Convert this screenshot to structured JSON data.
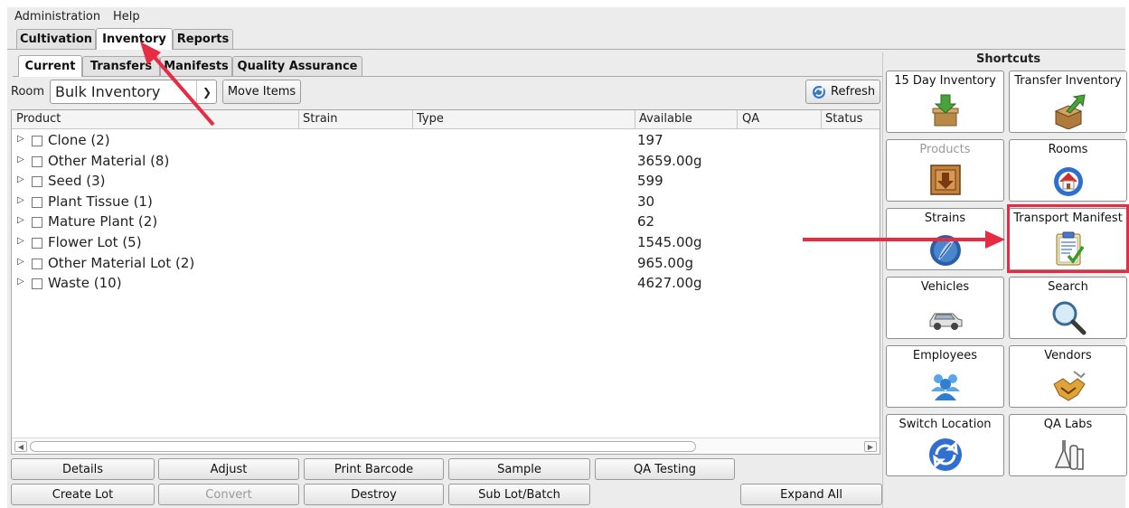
{
  "menubar": {
    "items": [
      "Administration",
      "Help"
    ]
  },
  "top_tabs": [
    "Cultivation",
    "Inventory",
    "Reports"
  ],
  "top_tabs_active": "Inventory",
  "sub_tabs": [
    "Current",
    "Transfers",
    "Manifests",
    "Quality Assurance"
  ],
  "sub_tabs_active": "Current",
  "toolbar": {
    "room_label": "Room",
    "room_value": "Bulk Inventory",
    "move_items": "Move Items",
    "refresh": "Refresh"
  },
  "table": {
    "columns": [
      "Product",
      "Strain",
      "Type",
      "Available",
      "QA",
      "Status"
    ],
    "rows": [
      {
        "product": "Clone (2)",
        "available": "197"
      },
      {
        "product": "Other Material (8)",
        "available": "3659.00g"
      },
      {
        "product": "Seed (3)",
        "available": "599"
      },
      {
        "product": "Plant Tissue (1)",
        "available": "30"
      },
      {
        "product": "Mature Plant (2)",
        "available": "62"
      },
      {
        "product": "Flower Lot (5)",
        "available": "1545.00g"
      },
      {
        "product": "Other Material Lot (2)",
        "available": "965.00g"
      },
      {
        "product": "Waste (10)",
        "available": "4627.00g"
      }
    ]
  },
  "actions": {
    "row1": [
      "Details",
      "Adjust",
      "Print Barcode",
      "Sample",
      "QA Testing"
    ],
    "row2": [
      "Create Lot",
      "Convert",
      "Destroy",
      "Sub Lot/Batch",
      "Expand All"
    ]
  },
  "shortcuts": {
    "title": "Shortcuts",
    "items": [
      {
        "label": "15 Day Inventory",
        "icon": "box-down-arrow-icon",
        "disabled": false
      },
      {
        "label": "Transfer Inventory",
        "icon": "box-out-arrow-icon",
        "disabled": false
      },
      {
        "label": "Products",
        "icon": "crate-icon",
        "disabled": true
      },
      {
        "label": "Rooms",
        "icon": "house-icon",
        "disabled": false
      },
      {
        "label": "Strains",
        "icon": "leaf-globe-icon",
        "disabled": false
      },
      {
        "label": "Transport Manifest",
        "icon": "clipboard-check-icon",
        "disabled": false
      },
      {
        "label": "Vehicles",
        "icon": "car-icon",
        "disabled": false
      },
      {
        "label": "Search",
        "icon": "magnifier-icon",
        "disabled": false
      },
      {
        "label": "Employees",
        "icon": "people-icon",
        "disabled": false
      },
      {
        "label": "Vendors",
        "icon": "handshake-icon",
        "disabled": false
      },
      {
        "label": "Switch Location",
        "icon": "cycle-arrows-icon",
        "disabled": false
      },
      {
        "label": "QA Labs",
        "icon": "lab-flask-icon",
        "disabled": false
      }
    ]
  },
  "colors": {
    "annotation": "#e52c43",
    "highlight": "#e52c43"
  }
}
